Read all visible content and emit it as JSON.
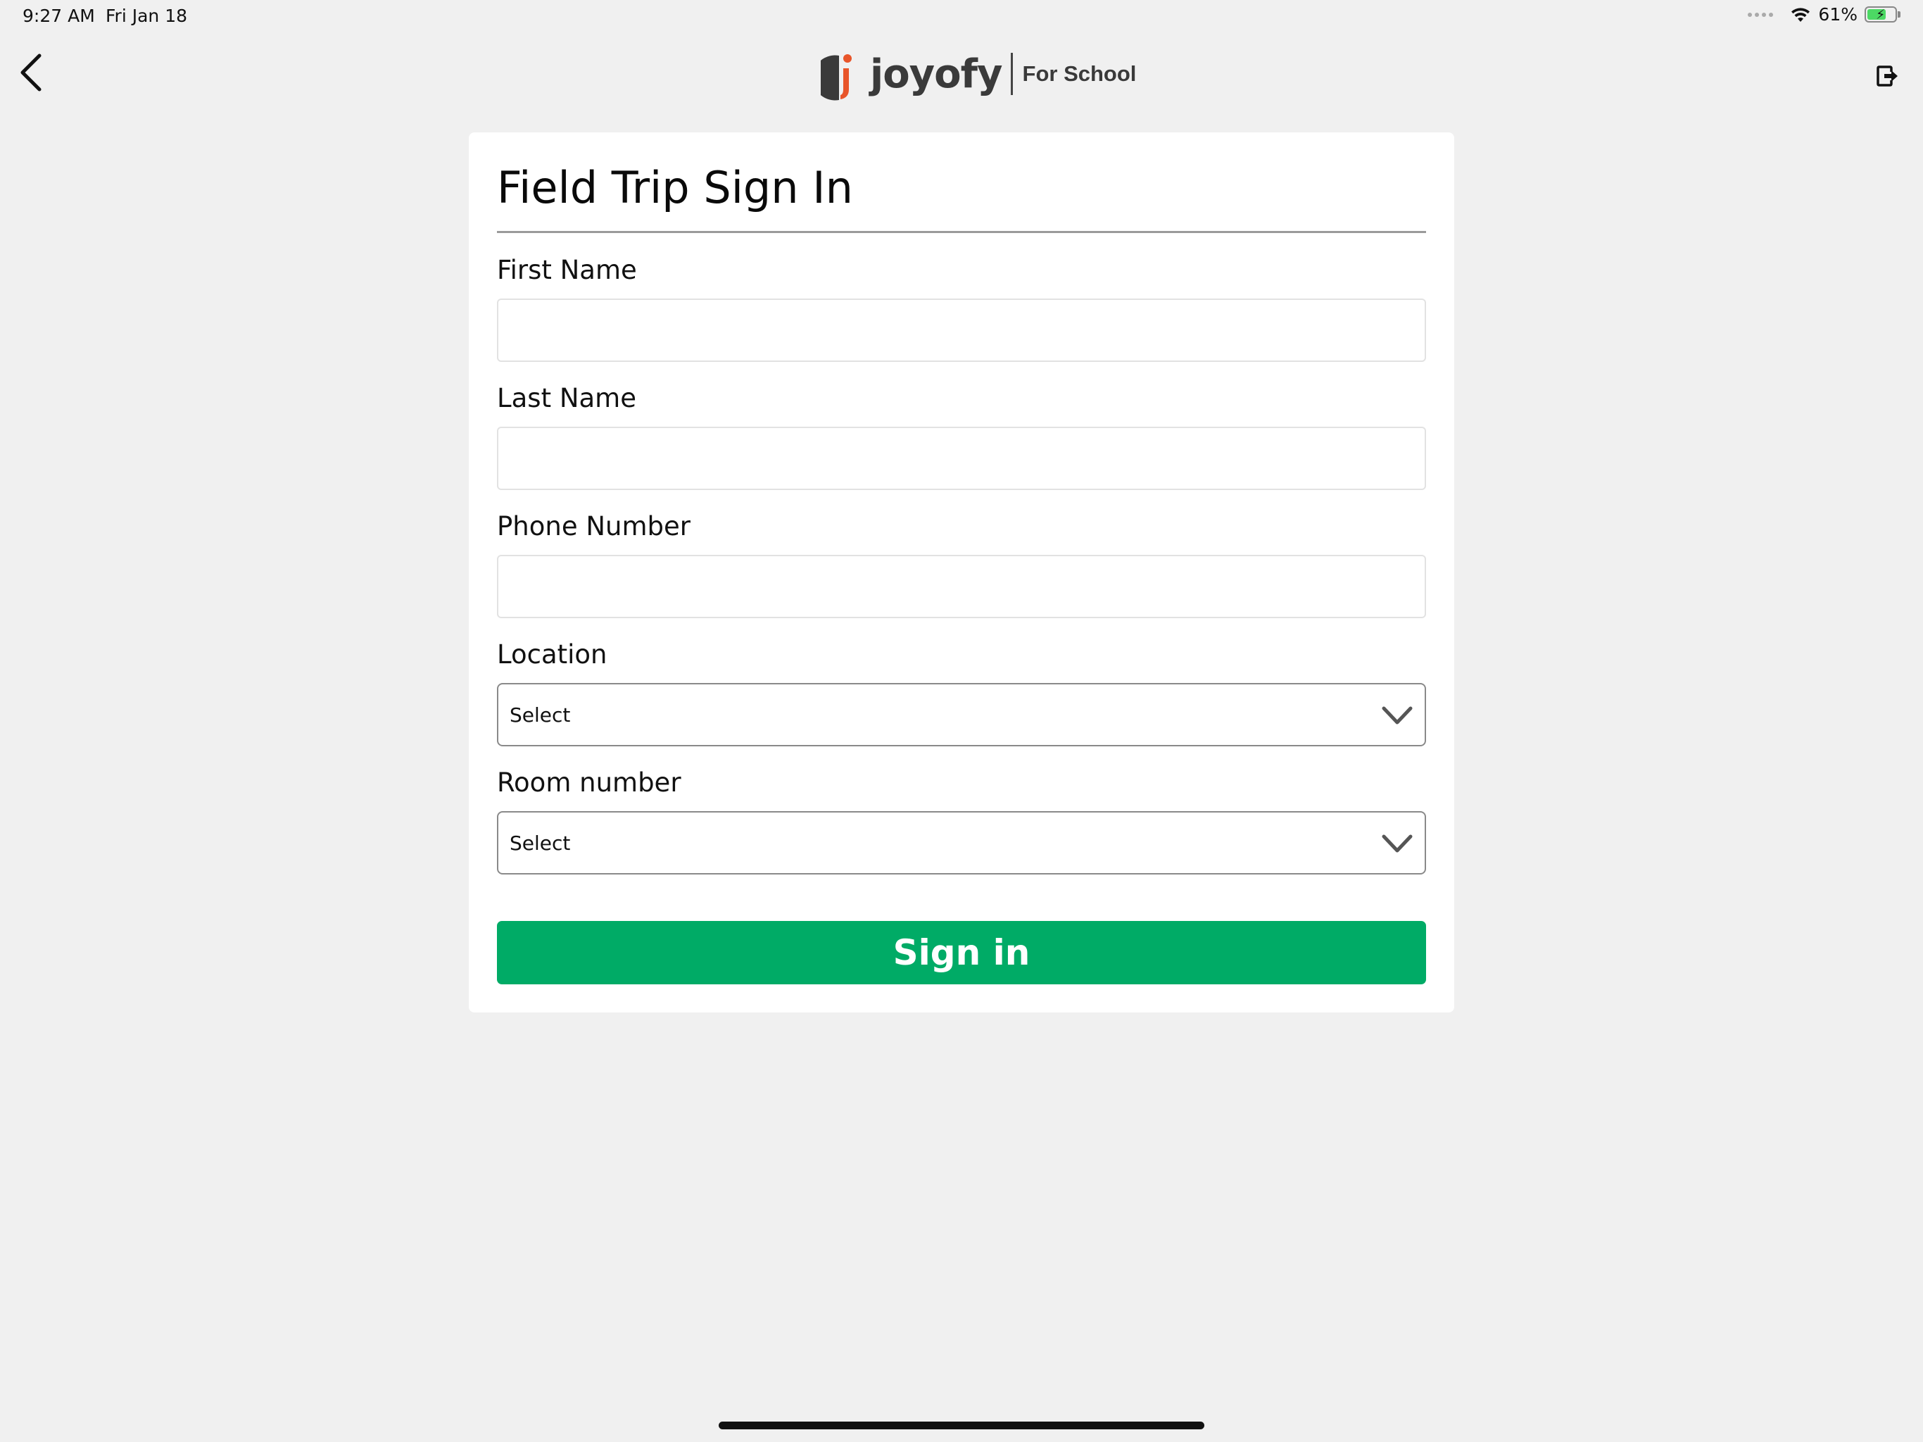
{
  "status_bar": {
    "time": "9:27 AM",
    "date": "Fri Jan 18",
    "battery_percent": "61%",
    "battery_level": 0.61,
    "battery_charging": true,
    "wifi_icon": "wifi-icon",
    "battery_color": "#4cd964"
  },
  "nav": {
    "back_icon": "chevron-left-icon",
    "exit_icon": "logout-icon",
    "logo": {
      "wordmark": "joyofy",
      "subtitle": "For School",
      "accent_color": "#e8552a",
      "text_color": "#3a3a3a"
    }
  },
  "form": {
    "title": "Field Trip Sign In",
    "fields": {
      "first_name": {
        "label": "First Name",
        "value": "",
        "placeholder": ""
      },
      "last_name": {
        "label": "Last Name",
        "value": "",
        "placeholder": ""
      },
      "phone_number": {
        "label": "Phone Number",
        "value": "",
        "placeholder": ""
      },
      "location": {
        "label": "Location",
        "selected": "Select"
      },
      "room_number": {
        "label": "Room number",
        "selected": "Select"
      }
    },
    "submit_label": "Sign in",
    "submit_color": "#00ab66"
  }
}
